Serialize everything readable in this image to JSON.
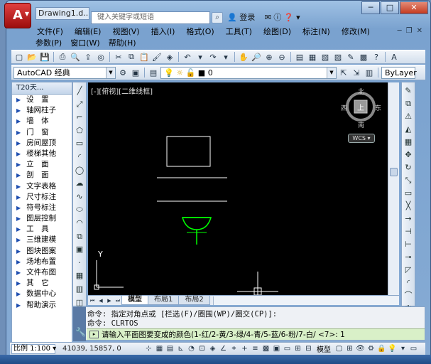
{
  "titlebar": {
    "app_logo": "A",
    "doc_title": "Drawing1.d...",
    "search_placeholder": "键入关键字或短语",
    "login": "登录",
    "window_buttons": [
      "─",
      "□",
      "✕"
    ]
  },
  "menu": {
    "row1": [
      "文件(F)",
      "编辑(E)",
      "视图(V)",
      "插入(I)",
      "格式(O)",
      "工具(T)",
      "绘图(D)",
      "标注(N)",
      "修改(M)"
    ],
    "row2": [
      "参数(P)",
      "窗口(W)",
      "帮助(H)"
    ]
  },
  "toolbar2": {
    "workspace": "AutoCAD 经典",
    "layer": "0",
    "bylayer": "ByLayer"
  },
  "t20": {
    "title": "T20天...",
    "items": [
      "设　置",
      "轴网柱子",
      "墙　体",
      "门　窗",
      "房间屋顶",
      "楼梯其他",
      "立　面",
      "剖　面",
      "文字表格",
      "尺寸标注",
      "符号标注",
      "图层控制",
      "工　具",
      "三维建模",
      "图块图案",
      "场地布置",
      "文件布图",
      "其　它",
      "数据中心",
      "帮助演示"
    ]
  },
  "canvas": {
    "view_label": "[-][俯视][二维线框]",
    "compass": {
      "n": "北",
      "s": "南",
      "e": "东",
      "w": "西",
      "center": "上"
    },
    "wcs": "WCS ▾",
    "y_axis": "Y"
  },
  "tabs": [
    "模型",
    "布局1",
    "布局2"
  ],
  "command": {
    "line1": "命令: 指定对角点或 [栏选(F)/圈围(WP)/圈交(CP)]:",
    "line2": "命令: CLRTOS",
    "prompt": "请输入平面图要变成的颜色(1-红/2-黄/3-绿/4-青/5-蓝/6-粉/7-白/ <7>: 1"
  },
  "status": {
    "scale": "比例 1:100 ▾",
    "coords": "41039, 15857, 0",
    "model": "模型"
  },
  "colors": {
    "accent": "#7aa2cf",
    "canvas": "#000000",
    "drawing_white": "#ffffff",
    "drawing_green": "#00ff00",
    "command_input": "#d9f0c8"
  }
}
